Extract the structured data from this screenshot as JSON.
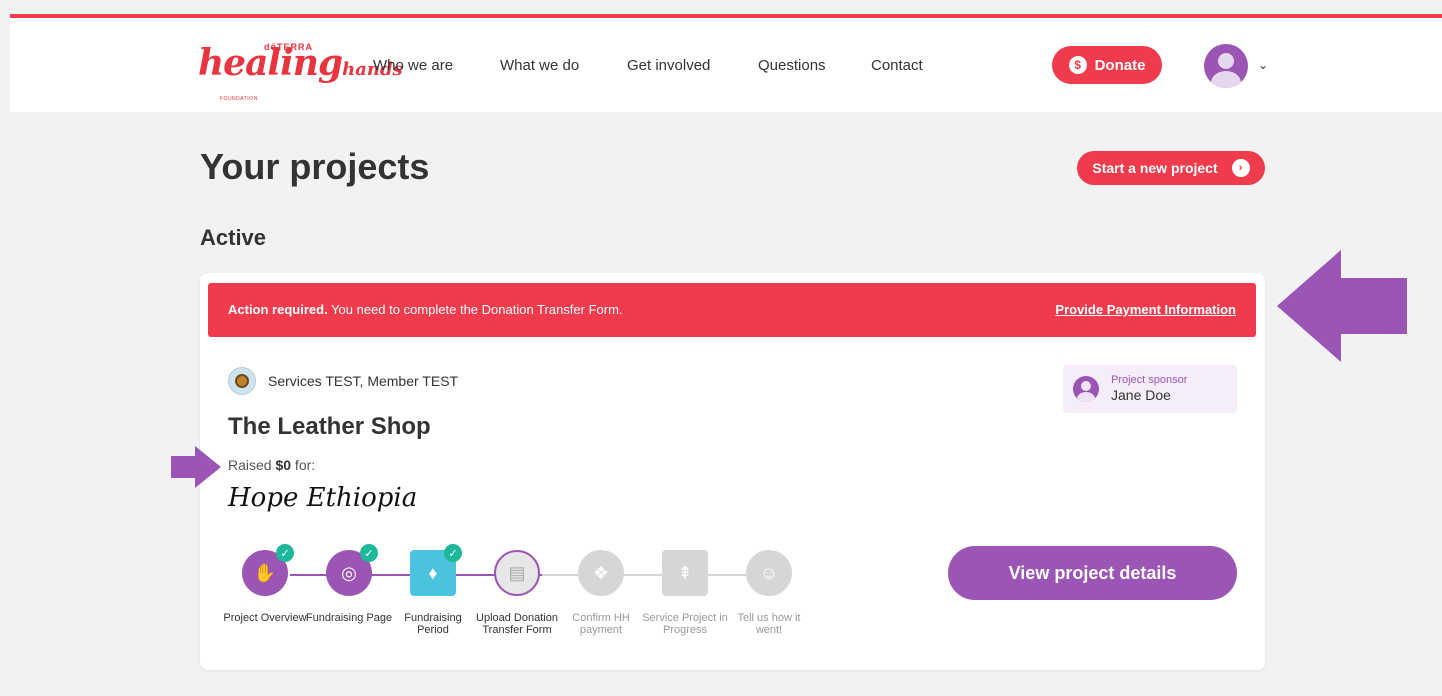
{
  "header": {
    "logo": {
      "script": "healing",
      "script_suffix": "hands",
      "brand": "dōTERRA",
      "foundation": "FOUNDATION"
    },
    "nav": [
      "Who we are",
      "What we do",
      "Get involved",
      "Questions",
      "Contact"
    ],
    "donate_label": "Donate",
    "donate_icon": "$",
    "chevron": "⌄"
  },
  "page": {
    "title": "Your projects",
    "start_label": "Start a new project",
    "section": "Active"
  },
  "card": {
    "alert": {
      "bold": "Action required.",
      "message": " You need to complete the Donation Transfer Form.",
      "link": "Provide Payment Information"
    },
    "owner": "Services TEST, Member TEST",
    "project_title": "The Leather Shop",
    "raised_prefix": "Raised ",
    "raised_amount": "$0",
    "raised_suffix": " for:",
    "organization": "Hope Ethiopia",
    "sponsor": {
      "label": "Project sponsor",
      "name": "Jane Doe"
    },
    "view_label": "View project details",
    "steps": [
      {
        "label": "Project Overview",
        "icon": "hand-icon",
        "state": "done"
      },
      {
        "label": "Fundraising Page",
        "icon": "coins-icon",
        "state": "done"
      },
      {
        "label": "Fundraising Period",
        "icon": "piggy-bank-icon",
        "state": "done"
      },
      {
        "label": "Upload Donation Transfer Form",
        "icon": "document-icon",
        "state": "current"
      },
      {
        "label": "Confirm HH payment",
        "icon": "handshake-icon",
        "state": "pending"
      },
      {
        "label": "Service Project in Progress",
        "icon": "tree-icon",
        "state": "pending"
      },
      {
        "label": "Tell us how it went!",
        "icon": "chat-icon",
        "state": "pending"
      }
    ]
  },
  "colors": {
    "accent": "#ef3b4c",
    "purple": "#9b55b4",
    "teal": "#4cc3dc",
    "check": "#1eb89a",
    "grey": "#d6d6d6"
  }
}
